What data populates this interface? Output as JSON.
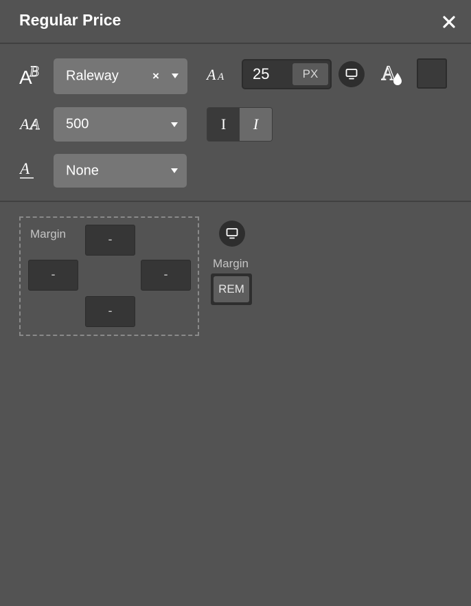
{
  "header": {
    "title": "Regular Price"
  },
  "typography": {
    "font_family": "Raleway",
    "font_size": "25",
    "font_size_unit": "PX",
    "font_weight": "500",
    "text_decoration": "None",
    "style_normal_label": "I",
    "style_italic_label": "I",
    "color": "#3a3a3a"
  },
  "spacing": {
    "box_label": "Margin",
    "top": "-",
    "left": "-",
    "right": "-",
    "bottom": "-",
    "side_label": "Margin",
    "unit": "REM"
  }
}
